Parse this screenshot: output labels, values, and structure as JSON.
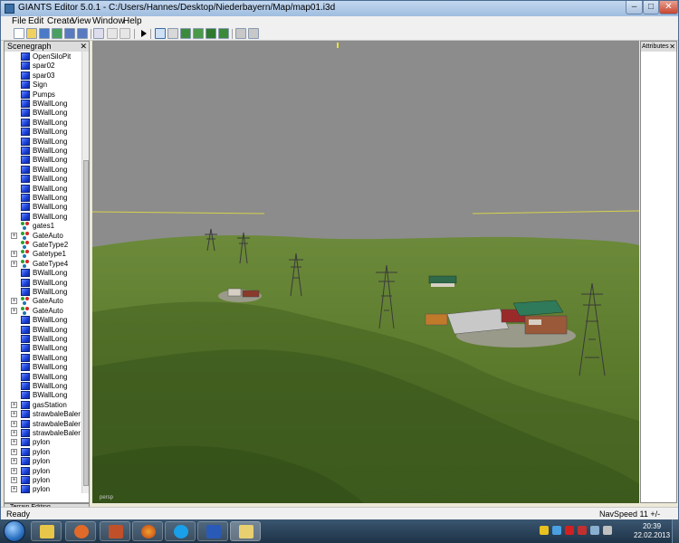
{
  "window": {
    "title": "GIANTS Editor 5.0.1 - C:/Users/Hannes/Desktop/Niederbayern/Map/map01.i3d"
  },
  "menu": [
    "File",
    "Edit",
    "Create",
    "View",
    "Window",
    "Help"
  ],
  "scenegraph": {
    "title": "Scenegraph",
    "close": "✕",
    "nodes": [
      {
        "label": "OpenSiloPit",
        "icon": "cube",
        "exp": false
      },
      {
        "label": "spar02",
        "icon": "cube",
        "exp": false
      },
      {
        "label": "spar03",
        "icon": "cube",
        "exp": false
      },
      {
        "label": "Sign",
        "icon": "cube",
        "exp": false
      },
      {
        "label": "Pumps",
        "icon": "cube",
        "exp": false
      },
      {
        "label": "BWallLong",
        "icon": "cube",
        "exp": false
      },
      {
        "label": "BWallLong",
        "icon": "cube",
        "exp": false
      },
      {
        "label": "BWallLong",
        "icon": "cube",
        "exp": false
      },
      {
        "label": "BWallLong",
        "icon": "cube",
        "exp": false
      },
      {
        "label": "BWallLong",
        "icon": "cube",
        "exp": false
      },
      {
        "label": "BWallLong",
        "icon": "cube",
        "exp": false
      },
      {
        "label": "BWallLong",
        "icon": "cube",
        "exp": false
      },
      {
        "label": "BWallLong",
        "icon": "cube",
        "exp": false
      },
      {
        "label": "BWallLong",
        "icon": "cube",
        "exp": false
      },
      {
        "label": "BWallLong",
        "icon": "cube",
        "exp": false
      },
      {
        "label": "BWallLong",
        "icon": "cube",
        "exp": false
      },
      {
        "label": "BWallLong",
        "icon": "cube",
        "exp": false
      },
      {
        "label": "BWallLong",
        "icon": "cube",
        "exp": false
      },
      {
        "label": "gates1",
        "icon": "transform-group",
        "exp": false
      },
      {
        "label": "GateAuto",
        "icon": "transform-group",
        "exp": true
      },
      {
        "label": "GateType2",
        "icon": "transform-group",
        "exp": false
      },
      {
        "label": "Gatetype1",
        "icon": "transform-group",
        "exp": true
      },
      {
        "label": "GateType4",
        "icon": "transform-group",
        "exp": true
      },
      {
        "label": "BWallLong",
        "icon": "cube",
        "exp": false
      },
      {
        "label": "BWallLong",
        "icon": "cube",
        "exp": false
      },
      {
        "label": "BWallLong",
        "icon": "cube",
        "exp": false
      },
      {
        "label": "GateAuto",
        "icon": "transform-group",
        "exp": true
      },
      {
        "label": "GateAuto",
        "icon": "transform-group",
        "exp": true
      },
      {
        "label": "BWallLong",
        "icon": "cube",
        "exp": false
      },
      {
        "label": "BWallLong",
        "icon": "cube",
        "exp": false
      },
      {
        "label": "BWallLong",
        "icon": "cube",
        "exp": false
      },
      {
        "label": "BWallLong",
        "icon": "cube",
        "exp": false
      },
      {
        "label": "BWallLong",
        "icon": "cube",
        "exp": false
      },
      {
        "label": "BWallLong",
        "icon": "cube",
        "exp": false
      },
      {
        "label": "BWallLong",
        "icon": "cube",
        "exp": false
      },
      {
        "label": "BWallLong",
        "icon": "cube",
        "exp": false
      },
      {
        "label": "BWallLong",
        "icon": "cube",
        "exp": false
      },
      {
        "label": "gasStation",
        "icon": "cube",
        "exp": true
      },
      {
        "label": "strawbaleBaler",
        "icon": "cube",
        "exp": true
      },
      {
        "label": "strawbaleBaler",
        "icon": "cube",
        "exp": true
      },
      {
        "label": "strawbaleBaler",
        "icon": "cube",
        "exp": true
      },
      {
        "label": "pylon",
        "icon": "cube",
        "exp": true
      },
      {
        "label": "pylon",
        "icon": "cube",
        "exp": true
      },
      {
        "label": "pylon",
        "icon": "cube",
        "exp": true
      },
      {
        "label": "pylon",
        "icon": "cube",
        "exp": true
      },
      {
        "label": "pylon",
        "icon": "cube",
        "exp": true
      },
      {
        "label": "pylon",
        "icon": "cube",
        "exp": true
      }
    ]
  },
  "terrain_tab": "Terrain Editing",
  "attributes": {
    "title": "Attributes",
    "close": "✕"
  },
  "viewport": {
    "camera_label": "persp"
  },
  "status": {
    "left": "Ready",
    "right": "NavSpeed 11 +/-"
  },
  "taskbar": {
    "time": "20:39",
    "date": "22.02.2013"
  },
  "colors": {
    "sky": "#8c8c8c",
    "grass": "#5b7a2c",
    "node_cube": "#1a3fd8"
  }
}
